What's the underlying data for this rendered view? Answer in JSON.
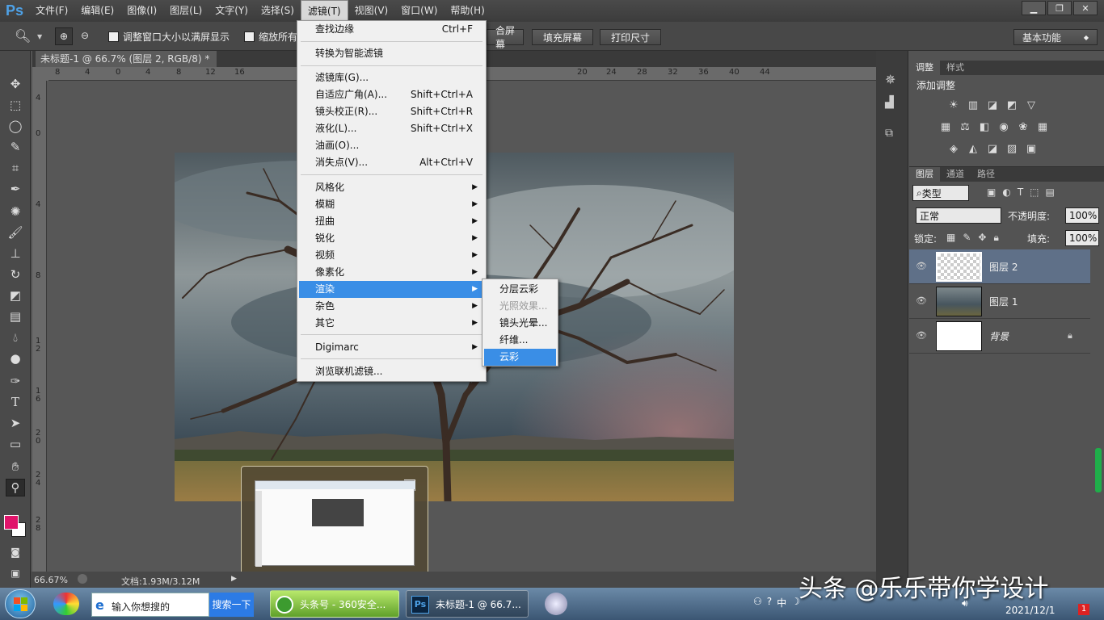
{
  "app": {
    "logo": "Ps"
  },
  "menubar": {
    "items": [
      "文件(F)",
      "编辑(E)",
      "图像(I)",
      "图层(L)",
      "文字(Y)",
      "选择(S)",
      "滤镜(T)",
      "视图(V)",
      "窗口(W)",
      "帮助(H)"
    ],
    "active": "滤镜(T)"
  },
  "window_controls": {
    "minimize": "▁",
    "restore": "❐",
    "close": "✕"
  },
  "options": {
    "resize_window_label": "调整窗口大小以满屏显示",
    "zoom_all_label": "缩放所有",
    "fit_screen_label": "合屏幕",
    "fill_screen_label": "填充屏幕",
    "print_size_label": "打印尺寸",
    "workspace": "基本功能"
  },
  "document": {
    "tab_title": "未标题-1 @ 66.7% (图层 2, RGB/8) *"
  },
  "ruler": {
    "h_ticks": [
      "8",
      "4",
      "0",
      "4",
      "8",
      "12",
      "16",
      "20",
      "24",
      "28",
      "32",
      "36",
      "40",
      "44"
    ],
    "v_ticks": [
      "4",
      "0",
      "4",
      "8",
      "1 2",
      "1 6",
      "2 0",
      "2 4",
      "2 8"
    ]
  },
  "status": {
    "zoom": "66.67%",
    "doc": "文档:1.93M/3.12M"
  },
  "filter_menu": {
    "items": [
      {
        "label": "查找边缘",
        "shortcut": "Ctrl+F"
      },
      {
        "label": "转换为智能滤镜",
        "shortcut": ""
      },
      {
        "label": "滤镜库(G)...",
        "shortcut": ""
      },
      {
        "label": "自适应广角(A)...",
        "shortcut": "Shift+Ctrl+A"
      },
      {
        "label": "镜头校正(R)...",
        "shortcut": "Shift+Ctrl+R"
      },
      {
        "label": "液化(L)...",
        "shortcut": "Shift+Ctrl+X"
      },
      {
        "label": "油画(O)...",
        "shortcut": ""
      },
      {
        "label": "消失点(V)...",
        "shortcut": "Alt+Ctrl+V"
      },
      {
        "label": "风格化",
        "shortcut": ""
      },
      {
        "label": "模糊",
        "shortcut": ""
      },
      {
        "label": "扭曲",
        "shortcut": ""
      },
      {
        "label": "锐化",
        "shortcut": ""
      },
      {
        "label": "视频",
        "shortcut": ""
      },
      {
        "label": "像素化",
        "shortcut": ""
      },
      {
        "label": "渲染",
        "shortcut": ""
      },
      {
        "label": "杂色",
        "shortcut": ""
      },
      {
        "label": "其它",
        "shortcut": ""
      },
      {
        "label": "Digimarc",
        "shortcut": ""
      },
      {
        "label": "浏览联机滤镜...",
        "shortcut": ""
      }
    ]
  },
  "render_submenu": {
    "items": [
      "分层云彩",
      "光照效果...",
      "镜头光晕...",
      "纤维...",
      "云彩"
    ],
    "highlighted": "云彩",
    "disabled": "光照效果..."
  },
  "adjust_panel": {
    "tabs": [
      "调整",
      "样式"
    ],
    "title": "添加调整"
  },
  "layers_panel": {
    "tabs": [
      "图层",
      "通道",
      "路径"
    ],
    "filter_kind": "类型",
    "blend_mode": "正常",
    "opacity_label": "不透明度:",
    "opacity": "100%",
    "lock_label": "锁定:",
    "fill_label": "填充:",
    "fill": "100%",
    "layers": [
      {
        "name": "图层 2"
      },
      {
        "name": "图层 1"
      },
      {
        "name": "背景"
      }
    ]
  },
  "taskbar": {
    "search_placeholder": "输入你想搜的",
    "search_button": "搜索一下",
    "tasks": [
      "头条号 - 360安全...",
      "未标题-1 @ 66.7..."
    ],
    "ime": "中",
    "date": "2021/12/1",
    "badge": "1"
  },
  "watermark": "头条 @乐乐带你学设计",
  "colors": {
    "foreground": "#e0146a",
    "background": "#ffffff",
    "accent": "#3a8ee6"
  }
}
